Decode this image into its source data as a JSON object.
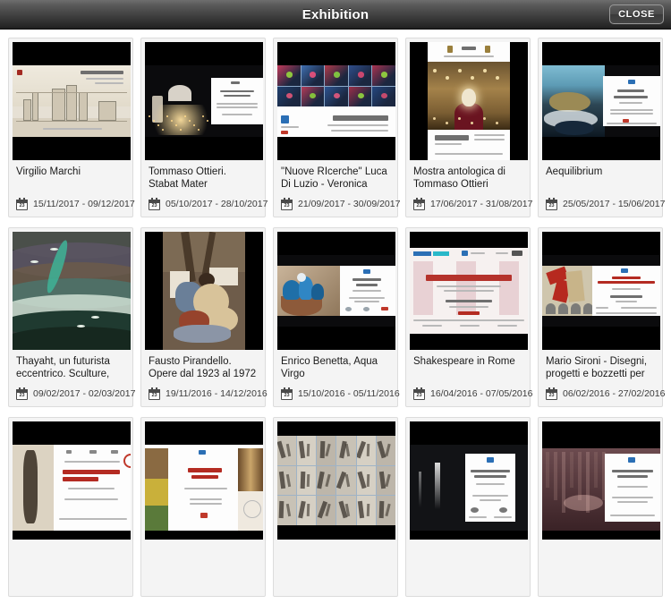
{
  "header": {
    "title": "Exhibition",
    "close_label": "CLOSE",
    "close_icon": "close-icon"
  },
  "grid": {
    "calendar_icon_day": "23",
    "cards": [
      {
        "title": "Virgilio Marchi",
        "dates": "15/11/2017 - 09/12/2017",
        "art": "p1"
      },
      {
        "title": "Tommaso Ottieri. Stabat Mater",
        "dates": "05/10/2017 - 28/10/2017",
        "art": "p2"
      },
      {
        "title": "\"Nuove RIcerche\" Luca Di Luzio - Veronica Montani…",
        "dates": "21/09/2017 - 30/09/2017",
        "art": "p3"
      },
      {
        "title": "Mostra antologica di Tommaso Ottieri",
        "dates": "17/06/2017 - 31/08/2017",
        "art": "p4"
      },
      {
        "title": "Aequilibrium",
        "dates": "25/05/2017 - 15/06/2017",
        "art": "p5"
      },
      {
        "title": "Thayaht, un futurista eccentrico. Sculture, pro…",
        "dates": "09/02/2017 - 02/03/2017",
        "art": "p6"
      },
      {
        "title": "Fausto Pirandello. Opere dal 1923 al 1972",
        "dates": "19/11/2016 - 14/12/2016",
        "art": "p7"
      },
      {
        "title": "Enrico Benetta, Aqua Virgo",
        "dates": "15/10/2016 - 05/11/2016",
        "art": "p8"
      },
      {
        "title": "Shakespeare in Rome",
        "dates": "16/04/2016 - 07/05/2016",
        "art": "p9"
      },
      {
        "title": "Mario Sironi - Disegni, progetti e bozzetti per \"Il…",
        "dates": "06/02/2016 - 27/02/2016",
        "art": "p10"
      },
      {
        "title": "",
        "dates": "",
        "art": "r3a"
      },
      {
        "title": "",
        "dates": "",
        "art": "r3b"
      },
      {
        "title": "",
        "dates": "",
        "art": "r3c"
      },
      {
        "title": "",
        "dates": "",
        "art": "r3d"
      },
      {
        "title": "",
        "dates": "",
        "art": "r3e"
      }
    ]
  },
  "colors": {
    "titlebar_top": "#6e6e6e",
    "titlebar_bottom": "#1f1f1f",
    "card_background": "#f4f4f4",
    "page_background": "#ffffff",
    "title_text": "#ffffff",
    "card_title_text": "#1a1a1a"
  }
}
